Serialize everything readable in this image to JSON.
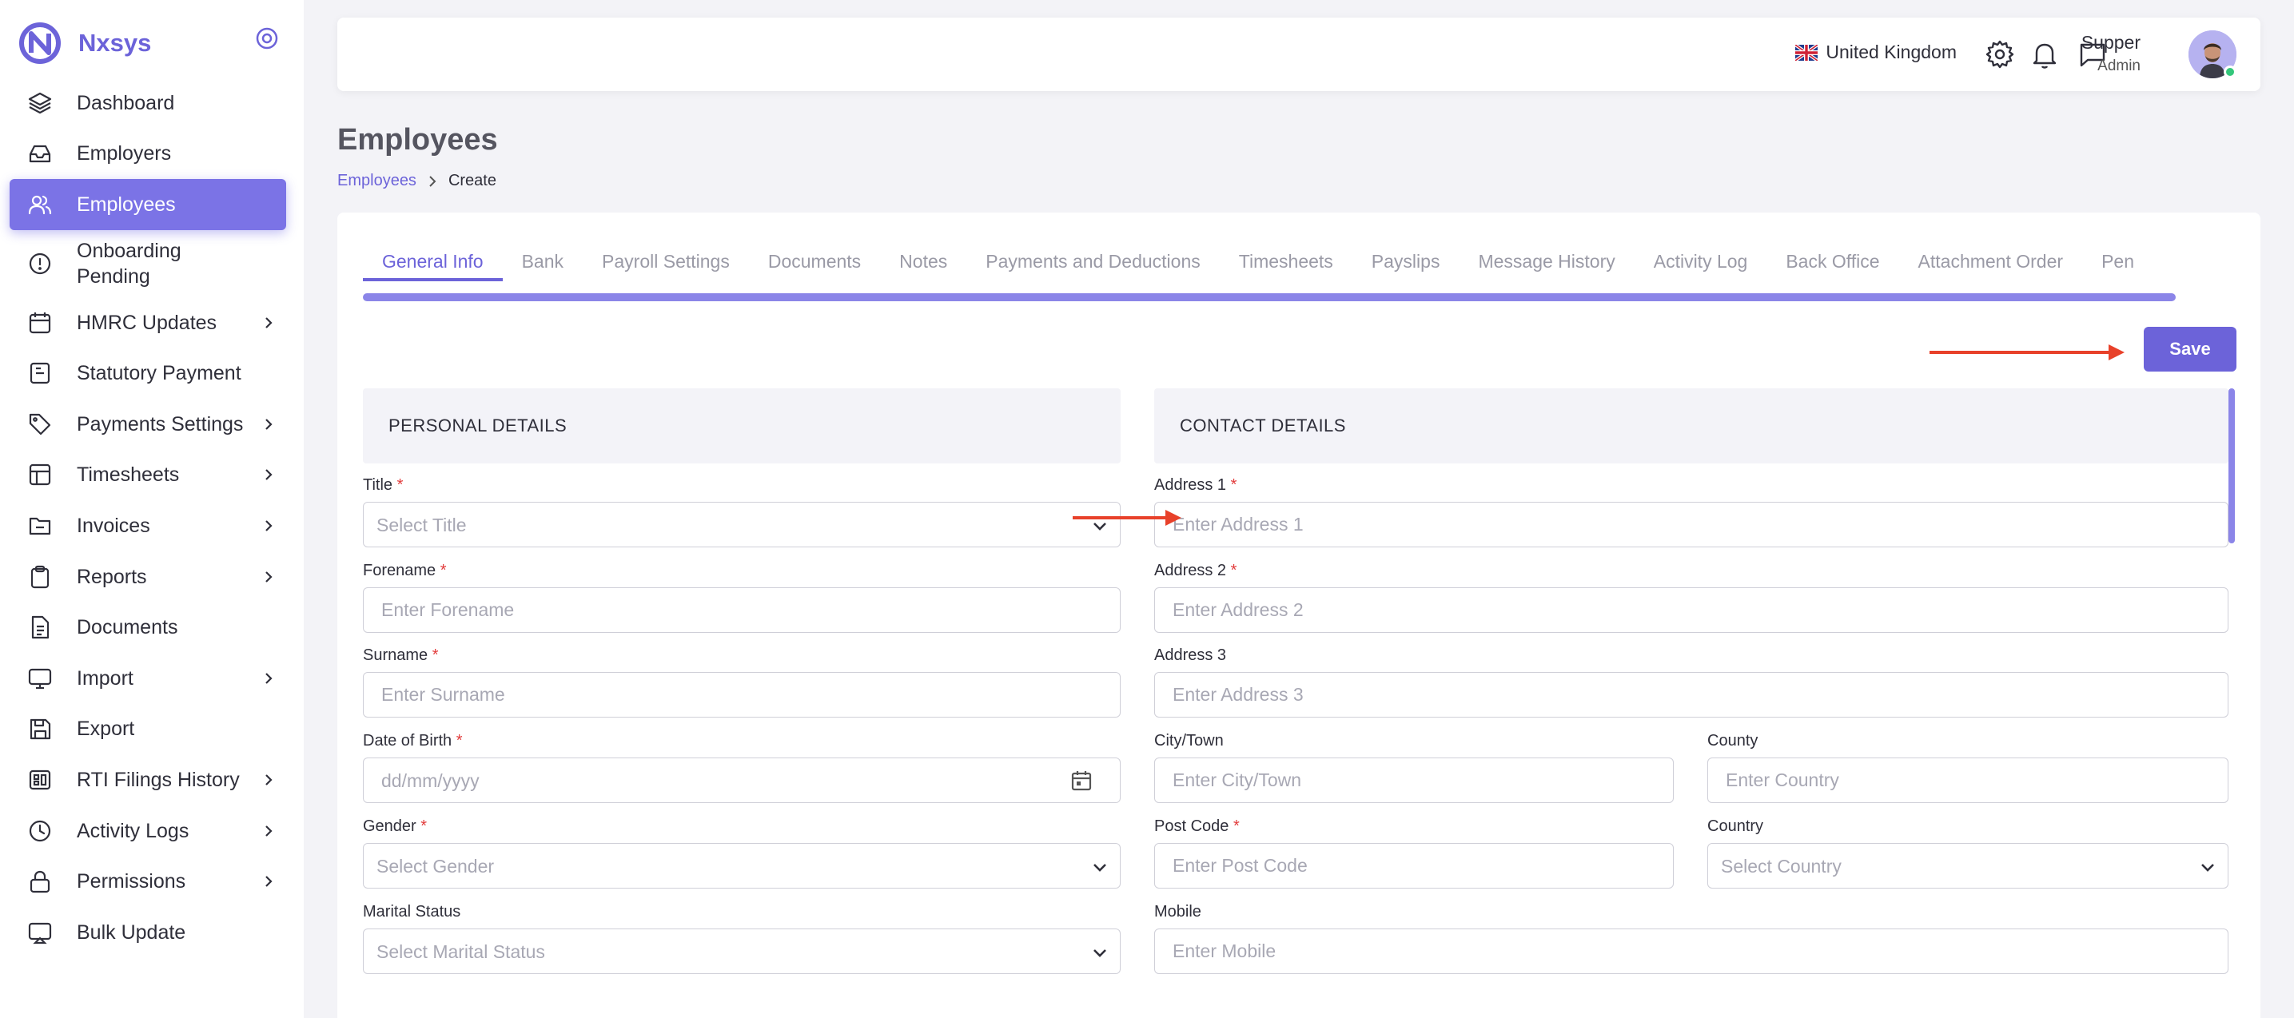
{
  "brand": {
    "name": "Nxsys"
  },
  "sidebar": {
    "items": [
      {
        "label": "Dashboard",
        "icon": "layers-icon",
        "chevron": false
      },
      {
        "label": "Employers",
        "icon": "inbox-icon",
        "chevron": false
      },
      {
        "label": "Employees",
        "icon": "users-icon",
        "chevron": false,
        "active": true
      },
      {
        "label": "Onboarding Pending",
        "icon": "alert-circle-icon",
        "chevron": false
      },
      {
        "label": "HMRC Updates",
        "icon": "calendar-icon",
        "chevron": true
      },
      {
        "label": "Statutory Payment",
        "icon": "file-minus-icon",
        "chevron": false
      },
      {
        "label": "Payments Settings",
        "icon": "tag-icon",
        "chevron": true
      },
      {
        "label": "Timesheets",
        "icon": "table-icon",
        "chevron": true
      },
      {
        "label": "Invoices",
        "icon": "folder-icon",
        "chevron": true
      },
      {
        "label": "Reports",
        "icon": "clipboard-icon",
        "chevron": true
      },
      {
        "label": "Documents",
        "icon": "file-text-icon",
        "chevron": false
      },
      {
        "label": "Import",
        "icon": "monitor-icon",
        "chevron": true
      },
      {
        "label": "Export",
        "icon": "save-icon",
        "chevron": false
      },
      {
        "label": "RTI Filings History",
        "icon": "grid-icon",
        "chevron": true
      },
      {
        "label": "Activity Logs",
        "icon": "clock-icon",
        "chevron": true
      },
      {
        "label": "Permissions",
        "icon": "lock-icon",
        "chevron": true
      },
      {
        "label": "Bulk Update",
        "icon": "cast-icon",
        "chevron": false
      }
    ]
  },
  "header": {
    "country": "United Kingdom",
    "user_name": "Supper",
    "user_role": "Admin"
  },
  "page": {
    "title": "Employees",
    "breadcrumb": {
      "link": "Employees",
      "current": "Create"
    }
  },
  "tabs": [
    "General Info",
    "Bank",
    "Payroll Settings",
    "Documents",
    "Notes",
    "Payments and Deductions",
    "Timesheets",
    "Payslips",
    "Message History",
    "Activity Log",
    "Back Office",
    "Attachment Order",
    "Pen"
  ],
  "form": {
    "save_label": "Save",
    "personal": {
      "heading": "PERSONAL DETAILS",
      "title_label": "Title",
      "title_placeholder": "Select Title",
      "forename_label": "Forename",
      "forename_placeholder": "Enter Forename",
      "surname_label": "Surname",
      "surname_placeholder": "Enter Surname",
      "dob_label": "Date of Birth",
      "dob_placeholder": "dd/mm/yyyy",
      "gender_label": "Gender",
      "gender_placeholder": "Select Gender",
      "marital_label": "Marital Status",
      "marital_placeholder": "Select Marital Status"
    },
    "contact": {
      "heading": "CONTACT DETAILS",
      "address1_label": "Address 1",
      "address1_placeholder": "Enter Address 1",
      "address2_label": "Address 2",
      "address2_placeholder": "Enter Address 2",
      "address3_label": "Address 3",
      "address3_placeholder": "Enter Address 3",
      "city_label": "City/Town",
      "city_placeholder": "Enter City/Town",
      "county_label": "County",
      "county_placeholder": "Enter Country",
      "postcode_label": "Post Code",
      "postcode_placeholder": "Enter Post Code",
      "country_label": "Country",
      "country_placeholder": "Select Country",
      "mobile_label": "Mobile",
      "mobile_placeholder": "Enter Mobile"
    },
    "required_mark": "*"
  },
  "colors": {
    "accent": "#6c63d9",
    "active_nav": "#7b73e6",
    "annotation_arrow": "#e8412a",
    "required": "#e23b3b"
  }
}
